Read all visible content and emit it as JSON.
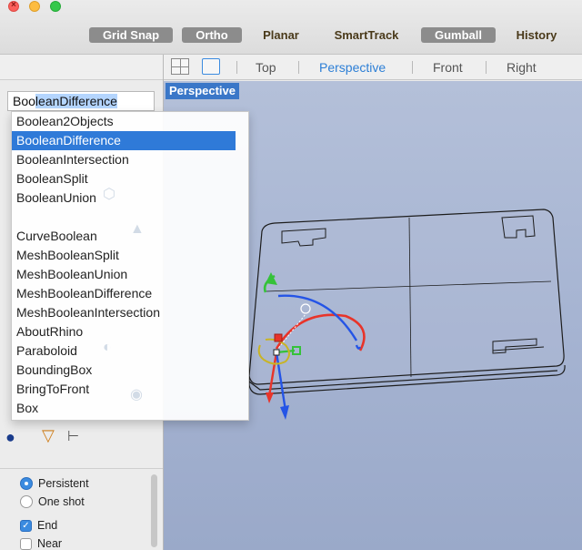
{
  "toolbar": {
    "osnaps": [
      {
        "label": "Grid Snap",
        "active": true
      },
      {
        "label": "Ortho",
        "active": true
      },
      {
        "label": "Planar",
        "active": false
      },
      {
        "label": "SmartTrack",
        "active": false
      },
      {
        "label": "Gumball",
        "active": true
      },
      {
        "label": "History",
        "active": false
      }
    ]
  },
  "viewport_tabs": [
    "Top",
    "Perspective",
    "Front",
    "Right"
  ],
  "active_viewport_tab": "Perspective",
  "viewport": {
    "label": "Perspective"
  },
  "command": {
    "typed": "Boo",
    "autocomplete": "leanDifference"
  },
  "autocomplete_items": [
    "Boolean2Objects",
    "BooleanDifference",
    "BooleanIntersection",
    "BooleanSplit",
    "BooleanUnion",
    "",
    "CurveBoolean",
    "MeshBooleanSplit",
    "MeshBooleanUnion",
    "MeshBooleanDifference",
    "MeshBooleanIntersection",
    "AboutRhino",
    "Paraboloid",
    "BoundingBox",
    "BringToFront",
    "Box"
  ],
  "selected_index": 1,
  "snap_options": {
    "persistent": "Persistent",
    "one_shot": "One shot",
    "end": "End",
    "near": "Near"
  },
  "colors": {
    "accent": "#2f7ad8",
    "viewport_bg": "#a6b4d2",
    "gumball_x": "#e8342a",
    "gumball_y": "#35c23a",
    "gumball_z": "#2454e6"
  }
}
